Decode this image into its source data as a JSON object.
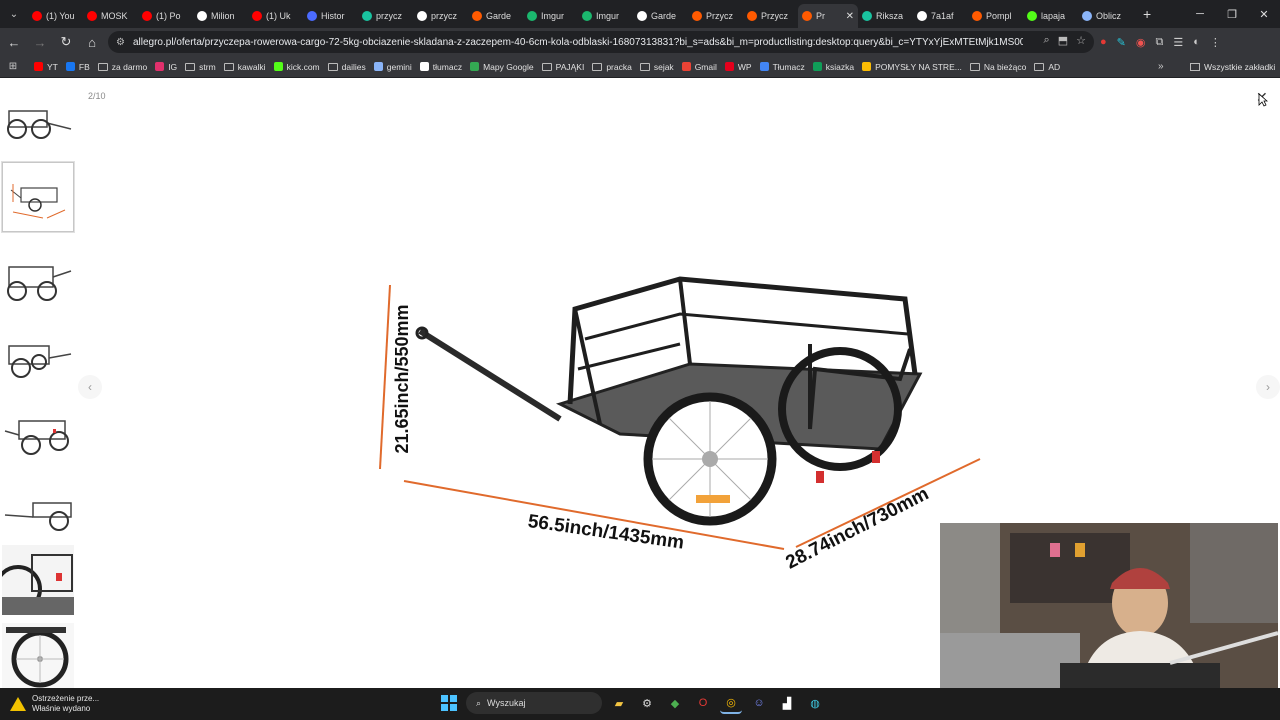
{
  "browser": {
    "tabs": [
      {
        "label": "(1) You",
        "color": "#ff0000"
      },
      {
        "label": "MOSK",
        "color": "#ff0000"
      },
      {
        "label": "(1) Po",
        "color": "#ff0000"
      },
      {
        "label": "Milion",
        "color": "#ffffff"
      },
      {
        "label": "(1) Uk",
        "color": "#ff0000"
      },
      {
        "label": "Histor",
        "color": "#4b6bff"
      },
      {
        "label": "przycz",
        "color": "#19c3a0"
      },
      {
        "label": "przycz",
        "color": "#ffffff"
      },
      {
        "label": "Garde",
        "color": "#ff5a00"
      },
      {
        "label": "Imgur",
        "color": "#1bb76e"
      },
      {
        "label": "Imgur",
        "color": "#1bb76e"
      },
      {
        "label": "Garde",
        "color": "#ffffff"
      },
      {
        "label": "Przycz",
        "color": "#ff5a00"
      },
      {
        "label": "Przycz",
        "color": "#ff5a00"
      },
      {
        "label": "Pr",
        "color": "#ff5a00",
        "active": true
      },
      {
        "label": "Riksza",
        "color": "#19c3a0"
      },
      {
        "label": "7a1af",
        "color": "#ffffff"
      },
      {
        "label": "Pompl",
        "color": "#ff5a00"
      },
      {
        "label": "lapaja",
        "color": "#53fc18"
      },
      {
        "label": "Oblicz",
        "color": "#8ab4f8"
      }
    ],
    "new_tab": "+",
    "url": "allegro.pl/oferta/przyczepa-rowerowa-cargo-72-5kg-obciazenie-skladana-z-zaczepem-40-6cm-kola-odblaski-16807313831?bi_s=ads&bi_m=productlisting:desktop:query&bi_c=YTYxYjExMTEtMjk1MS00MzUyLTliN2...",
    "bookmarks": [
      {
        "label": "YT",
        "kind": "icon",
        "color": "#ff0000"
      },
      {
        "label": "FB",
        "kind": "icon",
        "color": "#1877f2"
      },
      {
        "label": "za darmo",
        "kind": "folder"
      },
      {
        "label": "IG",
        "kind": "icon",
        "color": "#e1306c"
      },
      {
        "label": "strm",
        "kind": "folder"
      },
      {
        "label": "kawalki",
        "kind": "folder"
      },
      {
        "label": "kick.com",
        "kind": "icon",
        "color": "#53fc18"
      },
      {
        "label": "dailies",
        "kind": "folder"
      },
      {
        "label": "gemini",
        "kind": "icon",
        "color": "#8ab4f8"
      },
      {
        "label": "tłumacz",
        "kind": "icon",
        "color": "#ffffff"
      },
      {
        "label": "Mapy Google",
        "kind": "icon",
        "color": "#34a853"
      },
      {
        "label": "PAJĄKI",
        "kind": "folder"
      },
      {
        "label": "pracka",
        "kind": "folder"
      },
      {
        "label": "sejak",
        "kind": "folder"
      },
      {
        "label": "Gmail",
        "kind": "icon",
        "color": "#ea4335"
      },
      {
        "label": "WP",
        "kind": "icon",
        "color": "#e5001c"
      },
      {
        "label": "Tłumacz",
        "kind": "icon",
        "color": "#4285f4"
      },
      {
        "label": "ksiazka",
        "kind": "icon",
        "color": "#0f9d58"
      },
      {
        "label": "POMYSŁY NA STRE...",
        "kind": "icon",
        "color": "#fbbc04"
      },
      {
        "label": "Na bieżąco",
        "kind": "folder"
      },
      {
        "label": "AD",
        "kind": "folder"
      }
    ],
    "bookmarks_more": "»",
    "all_bookmarks": "Wszystkie zakładki"
  },
  "viewer": {
    "counter": "2/10",
    "dim_height": "21.65inch/550mm",
    "dim_length": "56.5inch/1435mm",
    "dim_width": "28.74inch/730mm",
    "thumbnail_count": 8,
    "selected_thumbnail": 2
  },
  "taskbar": {
    "notification_title": "Ostrzeżenie prze...",
    "notification_sub": "Właśnie wydano",
    "search_label": "Wyszukaj"
  },
  "colors": {
    "dimension_line": "#e06a2c",
    "chrome_dark": "#202124",
    "chrome_mid": "#35363a"
  }
}
